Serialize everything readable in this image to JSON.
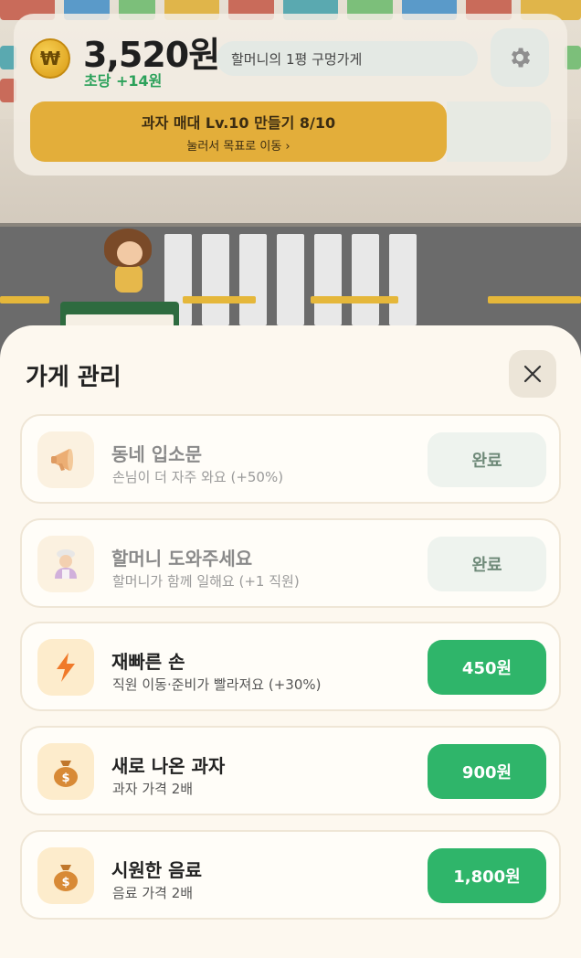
{
  "hud": {
    "coin_icon": "₩",
    "money": "3,520원",
    "rate": "초당 +14원",
    "shop_name": "할머니의 1평 구멍가게",
    "settings_icon": "gear-icon",
    "goal_title": "과자 매대 Lv.10 만들기 8/10",
    "goal_subtitle": "눌러서 목표로 이동 ›"
  },
  "sheet": {
    "title": "가게 관리",
    "close_icon": "close-icon",
    "items": [
      {
        "title": "동네 입소문",
        "description": "손님이 더 자주 와요 (+50%)",
        "button": "완료",
        "state": "done",
        "icon": "megaphone-icon"
      },
      {
        "title": "할머니 도와주세요",
        "description": "할머니가 함께 일해요 (+1 직원)",
        "button": "완료",
        "state": "done",
        "icon": "grandma-icon"
      },
      {
        "title": "재빠른 손",
        "description": "직원 이동·준비가 빨라져요 (+30%)",
        "button": "450원",
        "state": "buy",
        "icon": "lightning-icon"
      },
      {
        "title": "새로 나온 과자",
        "description": "과자 가격 2배",
        "button": "900원",
        "state": "buy",
        "icon": "money-bag-icon"
      },
      {
        "title": "시원한 음료",
        "description": "음료 가격 2배",
        "button": "1,800원",
        "state": "buy",
        "icon": "money-bag-icon"
      }
    ]
  },
  "colors": {
    "buy_button": "#2fb56a",
    "goal_button": "#e3ae3a",
    "rate_text": "#2ba15a",
    "sheet_bg": "#fdf8ef"
  }
}
